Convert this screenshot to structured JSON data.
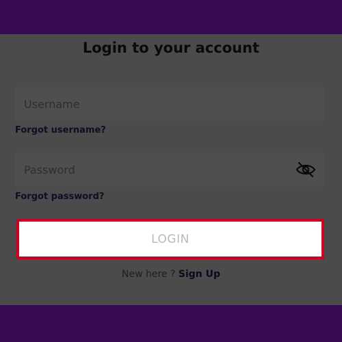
{
  "login": {
    "title": "Login to your account",
    "username_placeholder": "Username",
    "forgot_username": "Forgot username?",
    "password_placeholder": "Password",
    "forgot_password": "Forgot password?",
    "login_button": "LOGIN",
    "new_here": "New here ? ",
    "sign_up": "Sign Up"
  },
  "icons": {
    "password_toggle": "eye-slash-icon"
  },
  "colors": {
    "header_bar": "#3a0a52",
    "overlay": "#4b4b4b",
    "login_border": "#cc0022"
  }
}
